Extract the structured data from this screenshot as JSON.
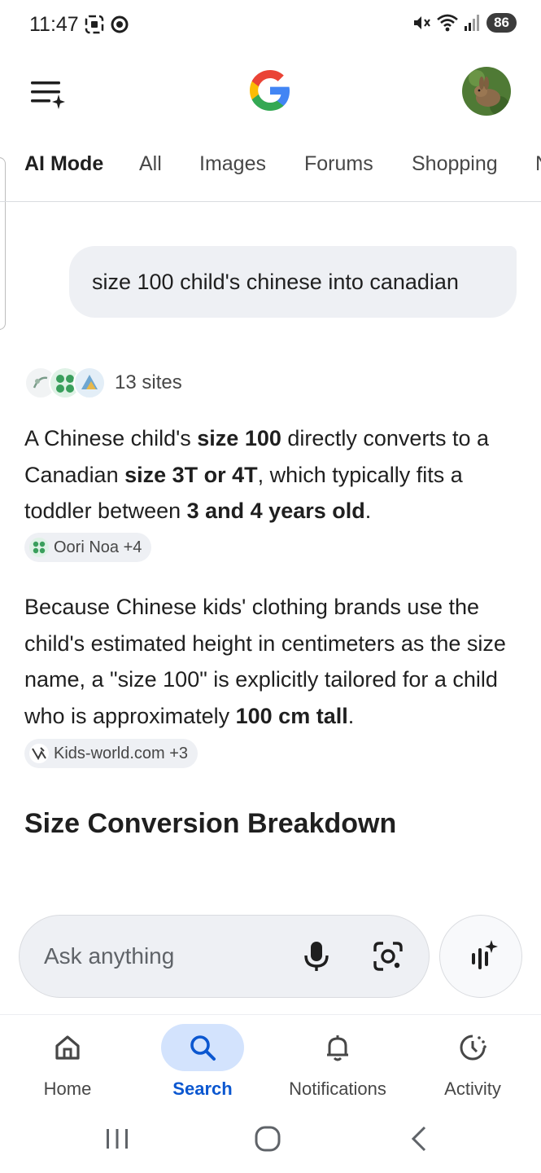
{
  "status_bar": {
    "time": "11:47",
    "battery": "86"
  },
  "header": {
    "menu_icon": "menu-sparkle-icon",
    "logo": "google-logo",
    "avatar": "rabbit-avatar"
  },
  "tabs": [
    "AI Mode",
    "All",
    "Images",
    "Forums",
    "Shopping",
    "N"
  ],
  "query": "size 100 child's chinese into canadian",
  "sources": {
    "count_label": "13 sites"
  },
  "answer": {
    "p1": {
      "t1": "A Chinese child's ",
      "b1": "size 100",
      "t2": " directly converts to a Canadian ",
      "b2": "size 3T or 4T",
      "t3": ", which typically fits a toddler between ",
      "b3": "3 and 4 years old",
      "t4": "."
    },
    "chip1": "Oori Noa +4",
    "p2": {
      "t1": "Because Chinese kids' clothing brands use the child's estimated height in centimeters as the size name, a \"size 100\" is explicitly tailored for a child who is approximately ",
      "b1": "100 cm tall",
      "t2": ". "
    },
    "chip2": "Kids-world.com +3"
  },
  "section_title": "Size Conversion Breakdown",
  "ask_bar": {
    "placeholder": "Ask anything"
  },
  "bottom_nav": [
    {
      "label": "Home",
      "icon": "home-icon"
    },
    {
      "label": "Search",
      "icon": "search-icon"
    },
    {
      "label": "Notifications",
      "icon": "bell-icon"
    },
    {
      "label": "Activity",
      "icon": "activity-icon"
    }
  ],
  "colors": {
    "accent": "#0b57d0",
    "active_pill": "#d3e3fd",
    "bubble": "#eef0f4"
  }
}
